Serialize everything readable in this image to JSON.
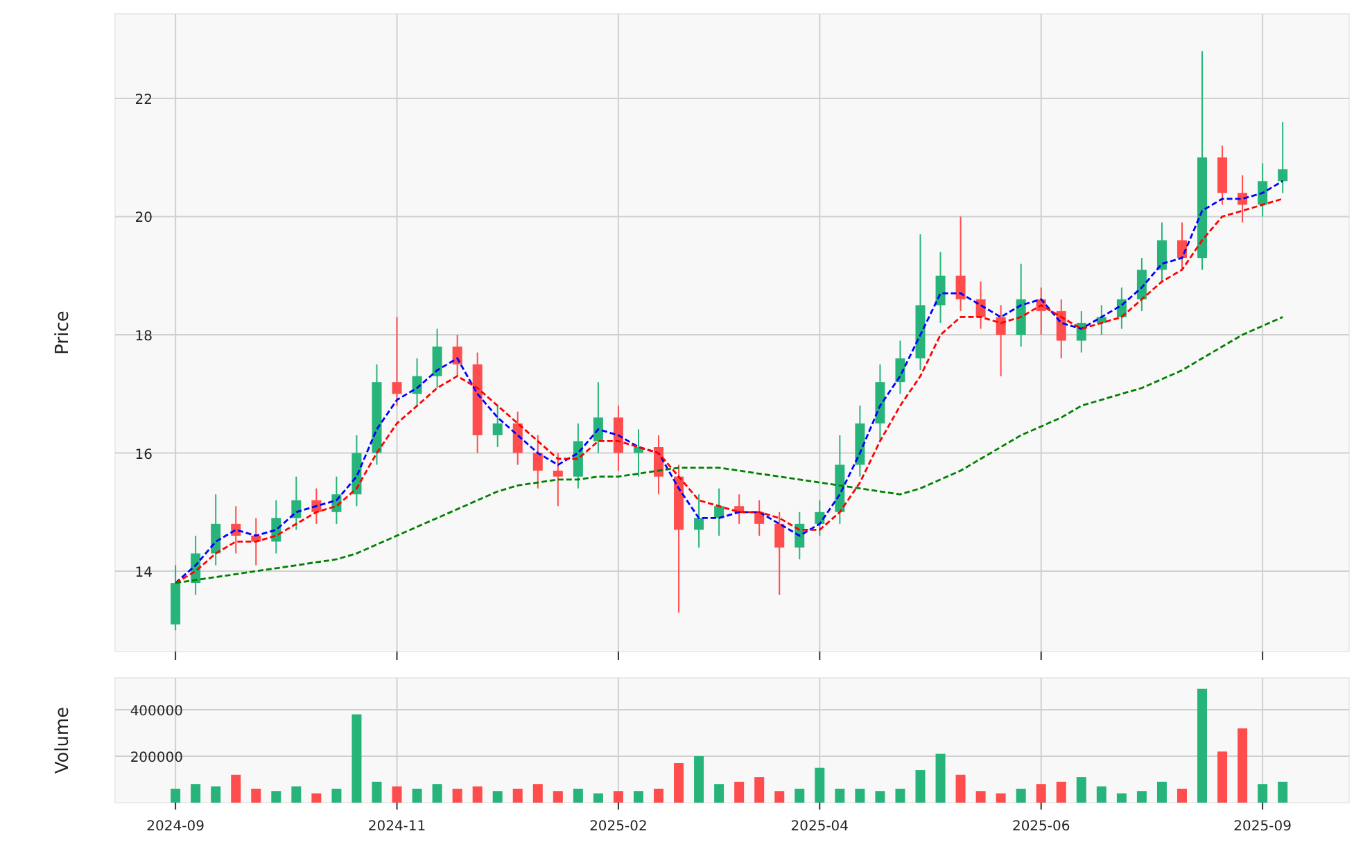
{
  "price_panel": {
    "chart_data": {
      "type": "candlestick",
      "ylabel": "Price",
      "grid": true,
      "ylim": [
        12.64,
        23.43
      ],
      "yticks": [
        14,
        16,
        18,
        20,
        22
      ],
      "categories": [
        null,
        null,
        null,
        null,
        null,
        null,
        null,
        null,
        null,
        null,
        null,
        null,
        null,
        null,
        null,
        null,
        null,
        null,
        null,
        null,
        null,
        null,
        null,
        null,
        null,
        null,
        null,
        null,
        null,
        null,
        null,
        null,
        null,
        null,
        null,
        null,
        null,
        null,
        null,
        null,
        null,
        null,
        null,
        null,
        null,
        null,
        null,
        null,
        null,
        null,
        null,
        null,
        null,
        null,
        null,
        null
      ],
      "ohlc": [
        [
          13.1,
          14.1,
          13.0,
          13.8
        ],
        [
          13.8,
          14.6,
          13.6,
          14.3
        ],
        [
          14.3,
          15.3,
          14.1,
          14.8
        ],
        [
          14.8,
          15.1,
          14.3,
          14.6
        ],
        [
          14.6,
          14.9,
          14.1,
          14.5
        ],
        [
          14.5,
          15.2,
          14.3,
          14.9
        ],
        [
          14.9,
          15.6,
          14.7,
          15.2
        ],
        [
          15.2,
          15.4,
          14.8,
          15.0
        ],
        [
          15.0,
          15.6,
          14.8,
          15.3
        ],
        [
          15.3,
          16.3,
          15.1,
          16.0
        ],
        [
          16.0,
          17.5,
          15.8,
          17.2
        ],
        [
          17.2,
          18.3,
          16.8,
          17.0
        ],
        [
          17.0,
          17.6,
          16.8,
          17.3
        ],
        [
          17.3,
          18.1,
          17.1,
          17.8
        ],
        [
          17.8,
          18.0,
          17.3,
          17.5
        ],
        [
          17.5,
          17.7,
          16.0,
          16.3
        ],
        [
          16.3,
          16.8,
          16.1,
          16.5
        ],
        [
          16.5,
          16.7,
          15.8,
          16.0
        ],
        [
          16.0,
          16.3,
          15.4,
          15.7
        ],
        [
          15.7,
          16.0,
          15.1,
          15.6
        ],
        [
          15.6,
          16.5,
          15.4,
          16.2
        ],
        [
          16.2,
          17.2,
          16.0,
          16.6
        ],
        [
          16.6,
          16.8,
          15.7,
          16.0
        ],
        [
          16.0,
          16.4,
          15.6,
          16.1
        ],
        [
          16.1,
          16.3,
          15.3,
          15.6
        ],
        [
          15.6,
          15.8,
          13.3,
          14.7
        ],
        [
          14.7,
          15.3,
          14.4,
          14.9
        ],
        [
          14.9,
          15.4,
          14.6,
          15.1
        ],
        [
          15.1,
          15.3,
          14.8,
          15.0
        ],
        [
          15.0,
          15.2,
          14.6,
          14.8
        ],
        [
          14.8,
          15.0,
          13.6,
          14.4
        ],
        [
          14.4,
          15.0,
          14.2,
          14.8
        ],
        [
          14.8,
          15.2,
          14.6,
          15.0
        ],
        [
          15.0,
          16.3,
          14.8,
          15.8
        ],
        [
          15.8,
          16.8,
          15.6,
          16.5
        ],
        [
          16.5,
          17.5,
          16.2,
          17.2
        ],
        [
          17.2,
          17.9,
          17.0,
          17.6
        ],
        [
          17.6,
          19.7,
          17.4,
          18.5
        ],
        [
          18.5,
          19.4,
          18.2,
          19.0
        ],
        [
          19.0,
          20.0,
          18.4,
          18.6
        ],
        [
          18.6,
          18.9,
          18.1,
          18.3
        ],
        [
          18.3,
          18.5,
          17.3,
          18.0
        ],
        [
          18.0,
          19.2,
          17.8,
          18.6
        ],
        [
          18.6,
          18.8,
          18.0,
          18.4
        ],
        [
          18.4,
          18.6,
          17.6,
          17.9
        ],
        [
          17.9,
          18.4,
          17.7,
          18.2
        ],
        [
          18.2,
          18.5,
          18.0,
          18.3
        ],
        [
          18.3,
          18.8,
          18.1,
          18.6
        ],
        [
          18.6,
          19.3,
          18.4,
          19.1
        ],
        [
          19.1,
          19.9,
          18.9,
          19.6
        ],
        [
          19.6,
          19.9,
          19.1,
          19.3
        ],
        [
          19.3,
          22.8,
          19.1,
          21.0
        ],
        [
          21.0,
          21.2,
          20.2,
          20.4
        ],
        [
          20.4,
          20.7,
          19.9,
          20.2
        ],
        [
          20.2,
          20.9,
          20.0,
          20.6
        ],
        [
          20.6,
          21.6,
          20.4,
          20.8
        ]
      ],
      "series": [
        {
          "type": "line",
          "line_style": "dashed",
          "color": "#0000ff",
          "values": [
            13.8,
            14.1,
            14.5,
            14.7,
            14.6,
            14.7,
            15.0,
            15.1,
            15.2,
            15.6,
            16.4,
            16.9,
            17.1,
            17.4,
            17.6,
            17.0,
            16.6,
            16.3,
            16.0,
            15.8,
            16.0,
            16.4,
            16.3,
            16.1,
            16.0,
            15.4,
            14.9,
            14.9,
            15.0,
            15.0,
            14.8,
            14.6,
            14.8,
            15.3,
            16.0,
            16.8,
            17.3,
            18.0,
            18.7,
            18.7,
            18.5,
            18.3,
            18.5,
            18.6,
            18.2,
            18.1,
            18.3,
            18.5,
            18.8,
            19.2,
            19.3,
            20.1,
            20.3,
            20.3,
            20.4,
            20.6
          ]
        },
        {
          "type": "line",
          "line_style": "dashed",
          "color": "#ff0000",
          "values": [
            13.8,
            14.0,
            14.3,
            14.5,
            14.5,
            14.6,
            14.8,
            15.0,
            15.1,
            15.4,
            16.0,
            16.5,
            16.8,
            17.1,
            17.3,
            17.1,
            16.8,
            16.5,
            16.2,
            15.9,
            15.9,
            16.2,
            16.2,
            16.1,
            16.0,
            15.6,
            15.2,
            15.1,
            15.0,
            15.0,
            14.9,
            14.7,
            14.7,
            15.0,
            15.5,
            16.2,
            16.8,
            17.3,
            18.0,
            18.3,
            18.3,
            18.2,
            18.3,
            18.5,
            18.3,
            18.1,
            18.2,
            18.3,
            18.6,
            18.9,
            19.1,
            19.6,
            20.0,
            20.1,
            20.2,
            20.3
          ]
        },
        {
          "type": "line",
          "line_style": "dashed",
          "color": "#008000",
          "values": [
            13.8,
            13.85,
            13.9,
            13.95,
            14.0,
            14.05,
            14.1,
            14.15,
            14.2,
            14.3,
            14.45,
            14.6,
            14.75,
            14.9,
            15.05,
            15.2,
            15.35,
            15.45,
            15.5,
            15.55,
            15.55,
            15.6,
            15.6,
            15.65,
            15.7,
            15.75,
            15.75,
            15.75,
            15.7,
            15.65,
            15.6,
            15.55,
            15.5,
            15.45,
            15.4,
            15.35,
            15.3,
            15.4,
            15.55,
            15.7,
            15.9,
            16.1,
            16.3,
            16.45,
            16.6,
            16.8,
            16.9,
            17.0,
            17.1,
            17.25,
            17.4,
            17.6,
            17.8,
            18.0,
            18.15,
            18.3
          ]
        }
      ]
    }
  },
  "volume_panel": {
    "chart_data": {
      "type": "bar",
      "ylabel": "Volume",
      "grid": true,
      "ylim": [
        0,
        537000
      ],
      "yticks": [
        200000,
        400000
      ],
      "categories": [
        "2024-09",
        null,
        null,
        null,
        null,
        null,
        null,
        null,
        null,
        null,
        null,
        "2024-11",
        null,
        null,
        null,
        null,
        null,
        null,
        null,
        null,
        null,
        null,
        "2025-02",
        null,
        null,
        null,
        null,
        null,
        null,
        null,
        null,
        null,
        "2025-04",
        null,
        null,
        null,
        null,
        null,
        null,
        null,
        null,
        null,
        null,
        "2025-06",
        null,
        null,
        null,
        null,
        null,
        null,
        null,
        null,
        null,
        null,
        "2025-09",
        null
      ],
      "values": [
        60000,
        80000,
        70000,
        120000,
        60000,
        50000,
        70000,
        40000,
        60000,
        380000,
        90000,
        70000,
        60000,
        80000,
        60000,
        70000,
        50000,
        60000,
        80000,
        50000,
        60000,
        40000,
        50000,
        50000,
        60000,
        170000,
        200000,
        80000,
        90000,
        110000,
        50000,
        60000,
        150000,
        60000,
        60000,
        50000,
        60000,
        140000,
        210000,
        120000,
        50000,
        40000,
        60000,
        80000,
        90000,
        110000,
        70000,
        40000,
        50000,
        90000,
        60000,
        490000,
        220000,
        320000,
        80000,
        90000
      ]
    }
  }
}
